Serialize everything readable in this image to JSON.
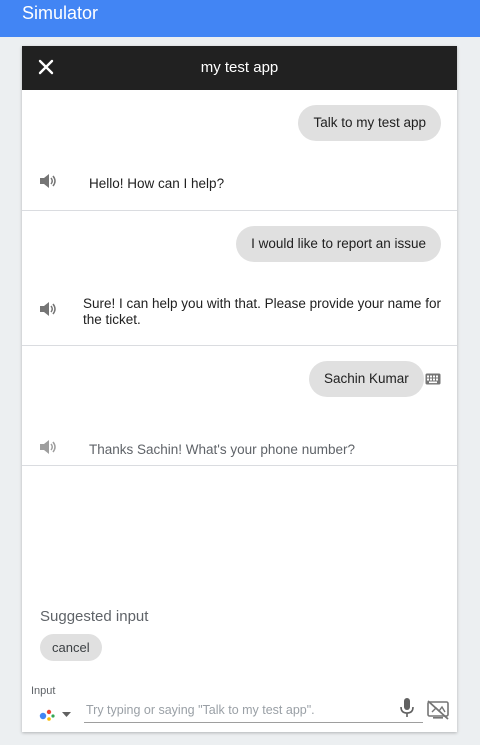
{
  "topbar": {
    "title": "Simulator"
  },
  "panel": {
    "title": "my test app",
    "conversation": [
      {
        "user": "Talk to my test app",
        "reply": "Hello! How can I help?"
      },
      {
        "user": "I would like to report an issue",
        "reply_line1": "Sure! I can help you with that. Please provide your name for",
        "reply_line2": "the ticket."
      },
      {
        "user": "Sachin Kumar",
        "reply": "Thanks Sachin! What's your phone number?"
      }
    ],
    "suggested": {
      "label": "Suggested input",
      "chips": [
        "cancel"
      ]
    },
    "input": {
      "label": "Input",
      "placeholder": "Try typing or saying \"Talk to my test app\"."
    }
  },
  "icons": {
    "close": "close-icon",
    "speaker": "speaker-icon",
    "keyboard": "keyboard-icon",
    "assistant": "assistant-icon",
    "mic": "mic-icon",
    "screen_off": "screen-off-icon"
  },
  "colors": {
    "topbar": "#4285f4",
    "header": "#212121",
    "bubble": "#e0e0e0"
  }
}
